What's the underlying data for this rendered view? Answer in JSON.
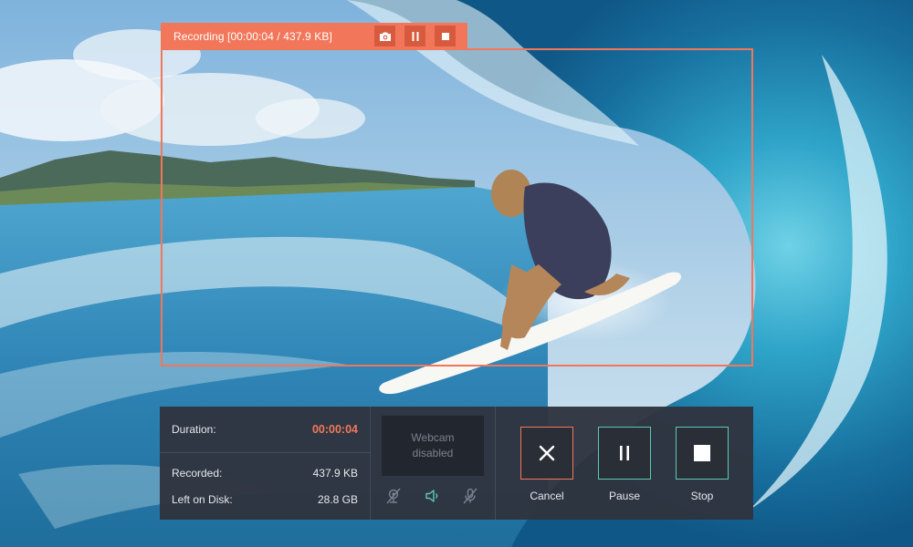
{
  "recording_bar": {
    "title": "Recording [00:00:04 / 437.9 KB]",
    "buttons": [
      "camera-icon",
      "pause-icon",
      "stop-icon"
    ]
  },
  "stats": {
    "duration_label": "Duration:",
    "duration_value": "00:00:04",
    "recorded_label": "Recorded:",
    "recorded_value": "437.9 KB",
    "disk_label": "Left on Disk:",
    "disk_value": "28.8 GB"
  },
  "webcam": {
    "status_text": "Webcam disabled"
  },
  "media_toggles": [
    "webcam-off-icon",
    "speaker-icon",
    "microphone-off-icon"
  ],
  "controls": {
    "cancel_label": "Cancel",
    "pause_label": "Pause",
    "stop_label": "Stop"
  },
  "colors": {
    "accent": "#f2775a",
    "teal": "#5ec9b4",
    "panel": "#2f343e"
  }
}
